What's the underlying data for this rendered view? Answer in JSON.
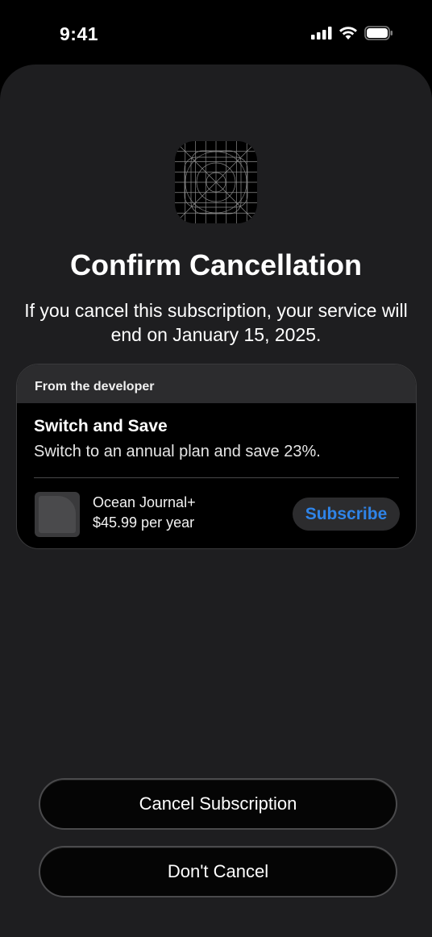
{
  "status_bar": {
    "time": "9:41",
    "icons": [
      "cellular-signal-icon",
      "wifi-icon",
      "battery-icon"
    ]
  },
  "sheet": {
    "app_icon": "app-grid-icon",
    "title": "Confirm Cancellation",
    "subtitle": "If you cancel this subscription, your service will end on January 15, 2025."
  },
  "offer": {
    "header": "From the developer",
    "title": "Switch and Save",
    "description": "Switch to an annual plan and save 23%.",
    "product_name": "Ocean Journal+",
    "product_price": "$45.99 per year",
    "subscribe_label": "Subscribe"
  },
  "actions": {
    "cancel_label": "Cancel Subscription",
    "dont_cancel_label": "Don't Cancel"
  },
  "colors": {
    "accent": "#2f84e8",
    "sheet_background": "#1e1e20",
    "card_background": "#000000"
  }
}
